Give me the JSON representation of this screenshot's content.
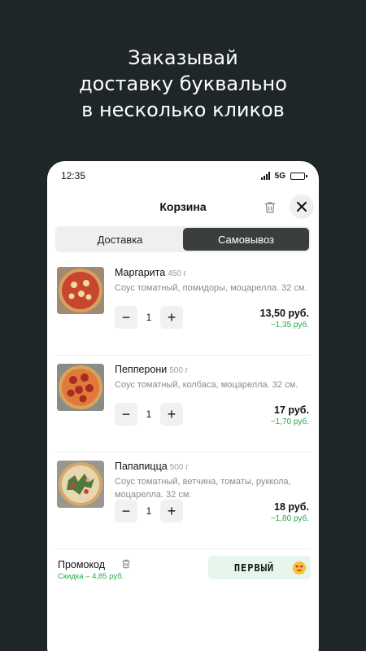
{
  "headline": [
    "Заказывай",
    "доставку буквально",
    "в несколько кликов"
  ],
  "status": {
    "time": "12:35",
    "network": "5G"
  },
  "header": {
    "title": "Корзина"
  },
  "tabs": [
    {
      "label": "Доставка",
      "active": false
    },
    {
      "label": "Самовывоз",
      "active": true
    }
  ],
  "items": [
    {
      "name": "Маргарита",
      "weight": "450 г",
      "desc": "Соус томатный, помидоры, моцарелла. 32 см.",
      "qty": "1",
      "price": "13,50 руб.",
      "discount": "−1,35 руб."
    },
    {
      "name": "Пепперони",
      "weight": "500 г",
      "desc": "Соус томатный, колбаса, моцарелла. 32 см.",
      "qty": "1",
      "price": "17 руб.",
      "discount": "−1,70 руб."
    },
    {
      "name": "Папапицца",
      "weight": "500 г",
      "desc": "Соус томатный, ветчина, томаты, руккола, моцарелла. 32 см.",
      "qty": "1",
      "price": "18 руб.",
      "discount": "−1,80 руб."
    }
  ],
  "promo": {
    "label": "Промокод",
    "discount": "Скидка – 4,85 руб.",
    "code": "ПЕРВЫЙ"
  },
  "colors": {
    "accent_green": "#2aa84a",
    "dark_bg": "#1e2628",
    "active_tab": "#3b3e3f"
  }
}
